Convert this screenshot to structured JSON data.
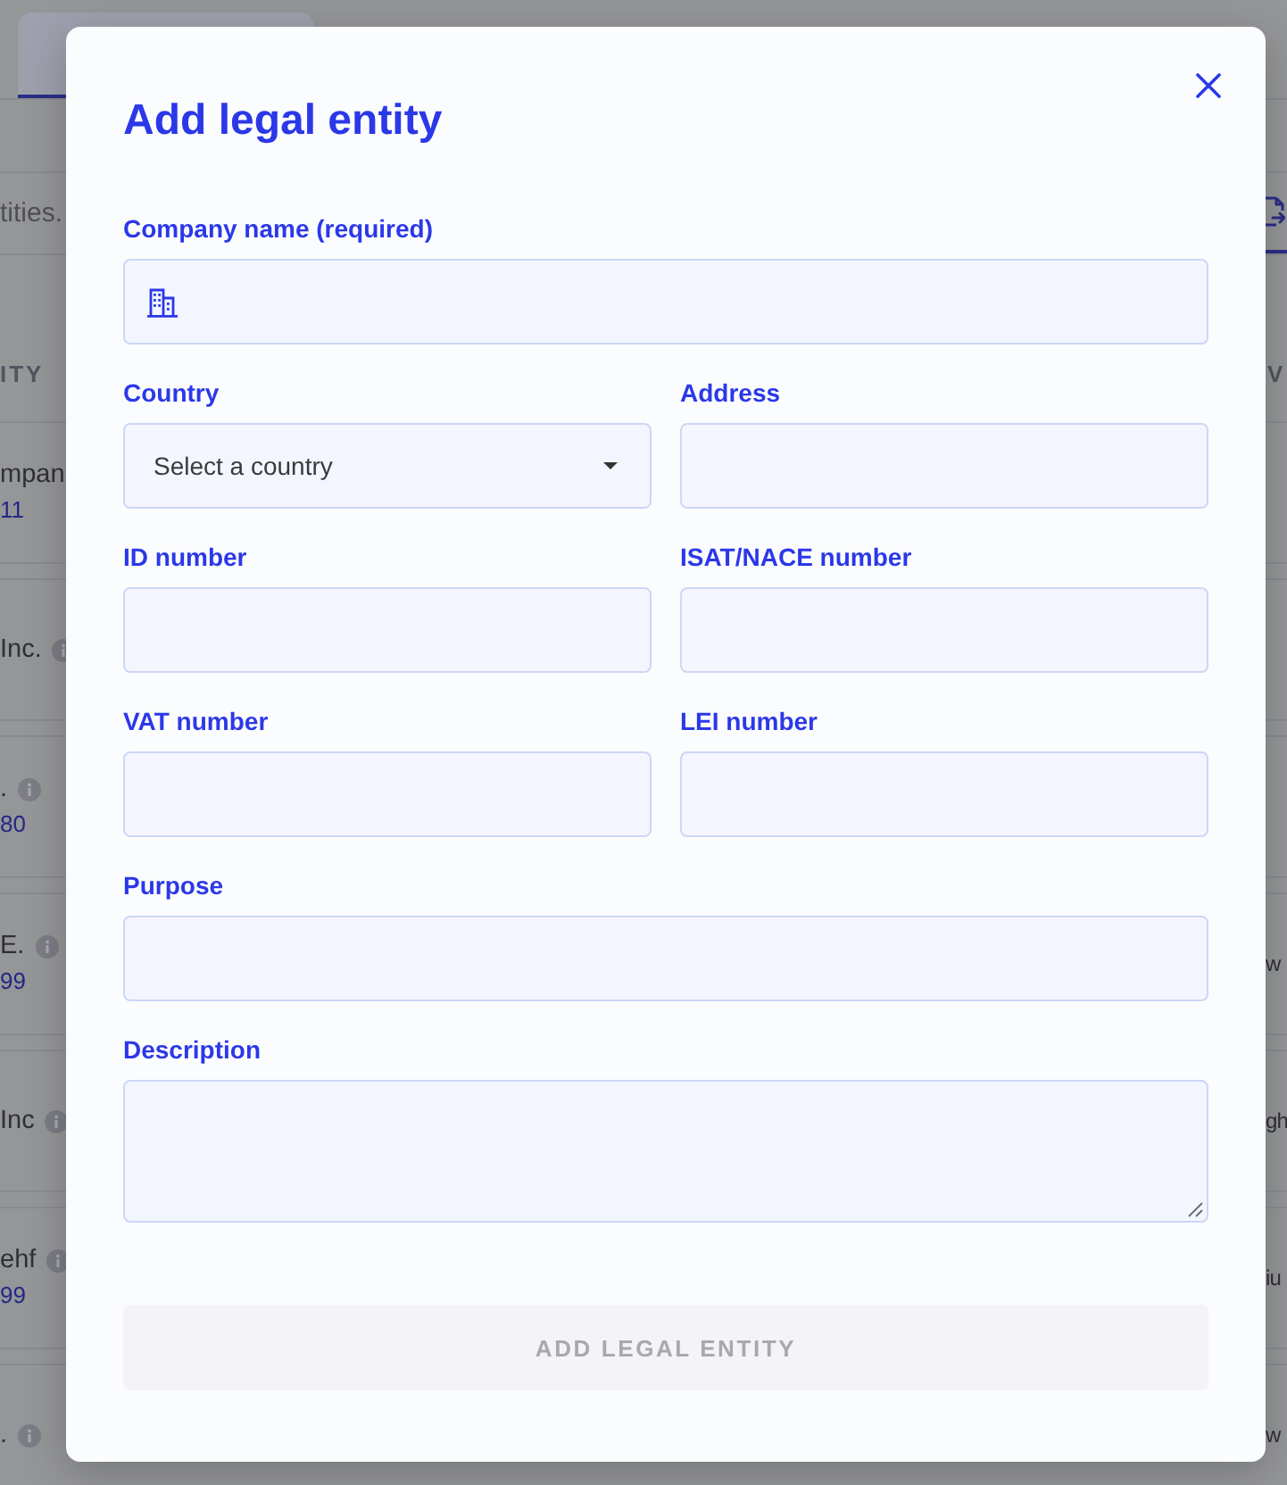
{
  "background": {
    "tabs": [
      {
        "selected": true
      }
    ],
    "search": {
      "placeholder": "tities."
    },
    "table": {
      "columns": [
        "ITY",
        "V"
      ],
      "rows": [
        {
          "column_1": "mpan",
          "column_1_detail": "11",
          "info_icon": false
        },
        {
          "column_1": "Inc.",
          "info_icon": true
        },
        {
          "column_1": ".",
          "column_1_detail": "80",
          "info_icon": true
        },
        {
          "column_1": "E.",
          "column_1_detail": "99",
          "info_icon": true,
          "column_2": "w"
        },
        {
          "column_1": "Inc",
          "info_icon": true,
          "column_2": "gh"
        },
        {
          "column_1": "ehf",
          "column_1_detail": "99",
          "info_icon": true,
          "column_2": "iu"
        },
        {
          "column_1": ".",
          "info_icon": true,
          "column_2": "w"
        }
      ]
    }
  },
  "dialog": {
    "title": "Add legal entity",
    "form_rows": [
      [
        {
          "kind": "icon_input",
          "label": "Company name (required)"
        }
      ],
      [
        {
          "kind": "select",
          "label": "Country",
          "placeholder": "Select a country"
        },
        {
          "kind": "input",
          "label": "Address"
        }
      ],
      [
        {
          "kind": "input",
          "label": "ID number"
        },
        {
          "kind": "input",
          "label": "ISAT/NACE number"
        }
      ],
      [
        {
          "kind": "input",
          "label": "VAT number"
        },
        {
          "kind": "input",
          "label": "LEI number"
        }
      ],
      [
        {
          "kind": "input",
          "label": "Purpose"
        }
      ],
      [
        {
          "kind": "textarea",
          "label": "Description"
        }
      ]
    ],
    "submit": {
      "label": "ADD LEGAL ENTITY",
      "disabled": true
    }
  }
}
